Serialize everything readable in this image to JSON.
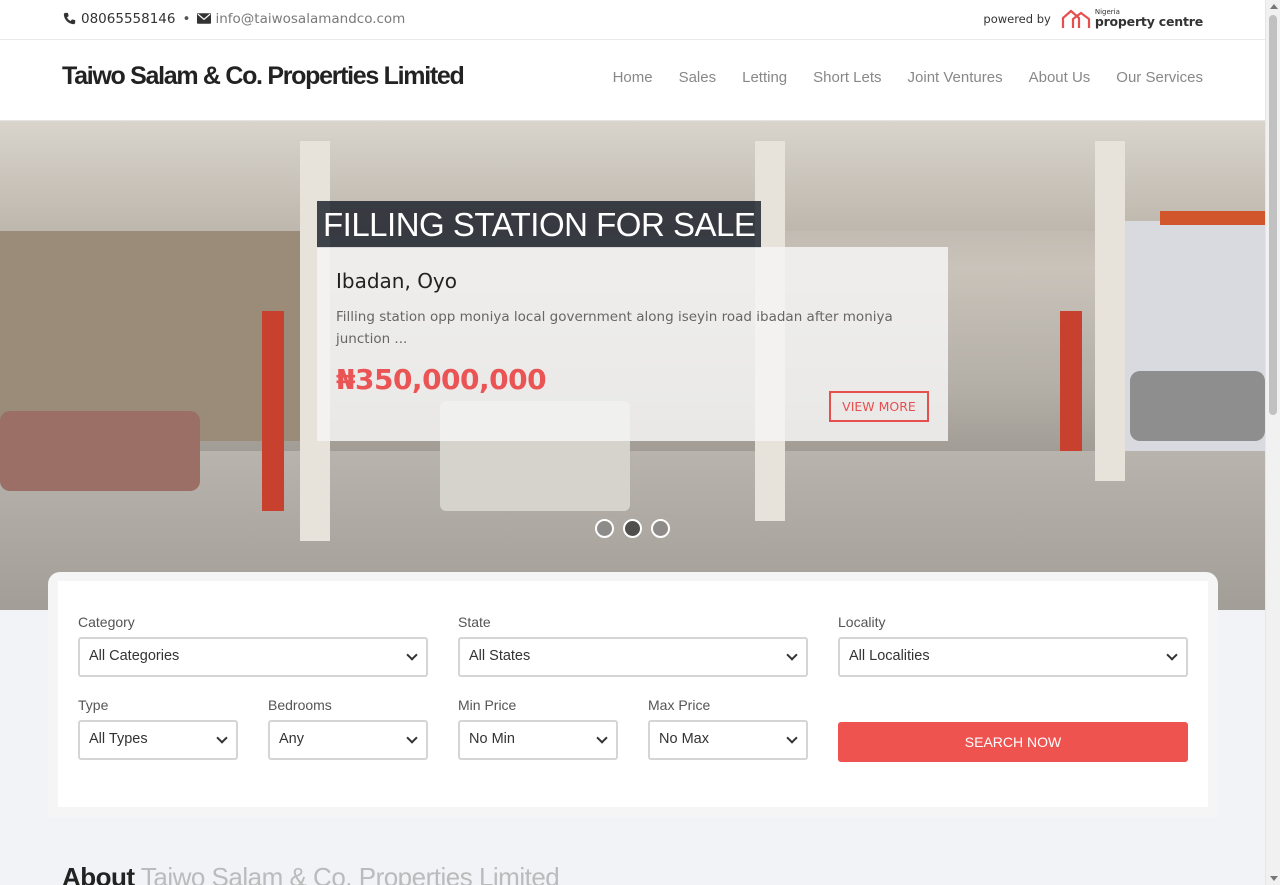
{
  "topbar": {
    "phone": "08065558146",
    "separator": "•",
    "email": "info@taiwosalamandco.com",
    "powered_by": "powered by",
    "partner_small": "Nigeria",
    "partner_name": "property centre"
  },
  "header": {
    "brand": "Taiwo Salam & Co. Properties Limited",
    "nav": [
      "Home",
      "Sales",
      "Letting",
      "Short Lets",
      "Joint Ventures",
      "About Us",
      "Our Services"
    ]
  },
  "hero": {
    "title": "FILLING STATION FOR SALE",
    "location": "Ibadan, Oyo",
    "description": "Filling station opp moniya local government along iseyin road ibadan after moniya junction ...",
    "price": "₦350,000,000",
    "view_more": "VIEW MORE",
    "slide_count": 3,
    "active_slide": 2
  },
  "search": {
    "category": {
      "label": "Category",
      "value": "All Categories"
    },
    "state": {
      "label": "State",
      "value": "All States"
    },
    "locality": {
      "label": "Locality",
      "value": "All Localities"
    },
    "type": {
      "label": "Type",
      "value": "All Types"
    },
    "bedrooms": {
      "label": "Bedrooms",
      "value": "Any"
    },
    "min_price": {
      "label": "Min Price",
      "value": "No Min"
    },
    "max_price": {
      "label": "Max Price",
      "value": "No Max"
    },
    "button": "SEARCH NOW"
  },
  "about": {
    "heading_bold": "About",
    "heading_light": "Taiwo Salam & Co. Properties Limited"
  },
  "colors": {
    "accent": "#ef5350",
    "price": "#ea5454"
  }
}
